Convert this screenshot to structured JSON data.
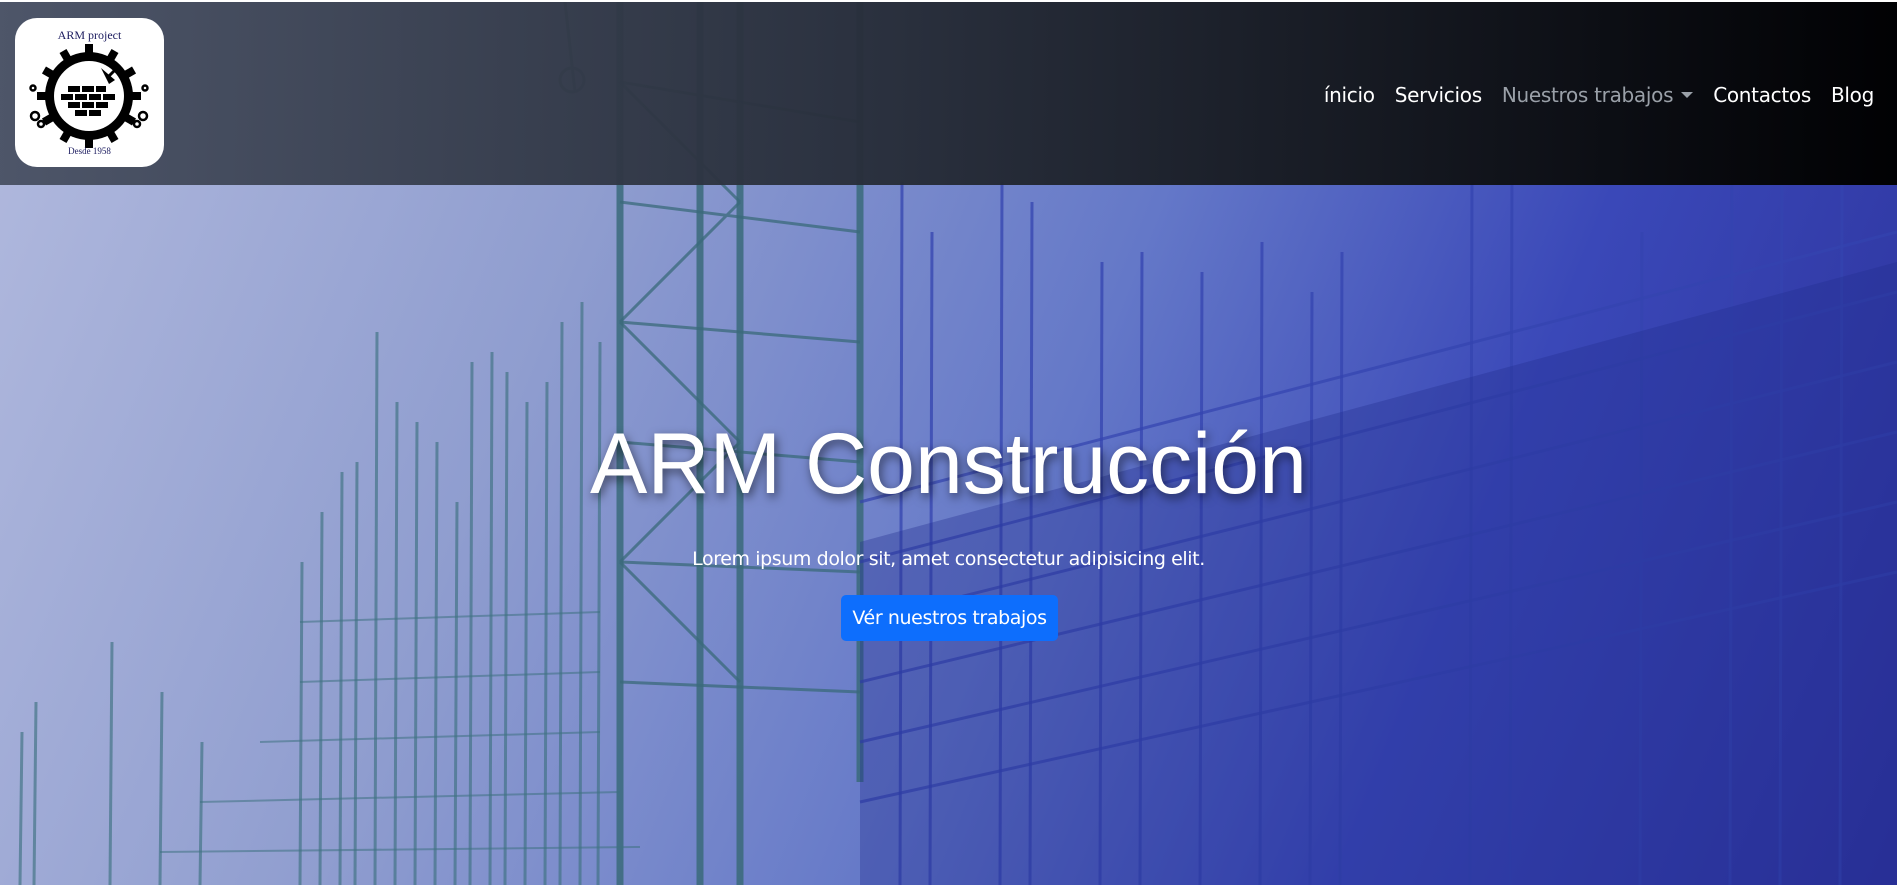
{
  "logo": {
    "text_top": "ARM project",
    "text_bottom": "Desde 1958"
  },
  "nav": {
    "items": [
      {
        "label": "ínicio"
      },
      {
        "label": "Servicios"
      },
      {
        "label": "Nuestros trabajos",
        "dropdown": true,
        "icon": "chevron-down-icon"
      },
      {
        "label": "Contactos"
      },
      {
        "label": "Blog"
      }
    ]
  },
  "hero": {
    "title": "ARM Construcción",
    "subtitle": "Lorem ipsum dolor sit, amet consectetur adipisicing elit.",
    "cta_label": "Vér nuestros trabajos"
  },
  "colors": {
    "accent": "#0d6efd",
    "navbar": "#000000",
    "hero_overlay": "#2b3099"
  }
}
